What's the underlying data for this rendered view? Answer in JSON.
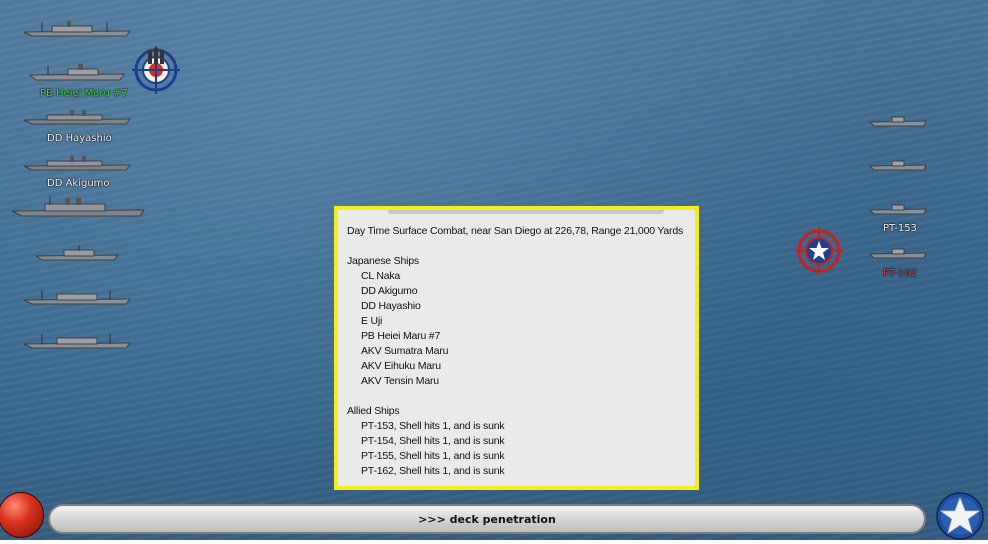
{
  "combat": {
    "header": "Day Time Surface Combat, near San Diego at 226,78, Range 21,000 Yards",
    "japanese_title": "Japanese Ships",
    "japanese_ships": [
      "CL Naka",
      "DD Akigumo",
      "DD Hayashio",
      "E Uji",
      "PB Heiei Maru #7",
      "AKV Sumatra Maru",
      "AKV Eihuku Maru",
      "AKV Tensin Maru"
    ],
    "allied_title": "Allied Ships",
    "allied_ships": [
      "PT-153, Shell hits 1, and is sunk",
      "PT-154, Shell hits 1, and is sunk",
      "PT-155, Shell hits 1, and is sunk",
      "PT-162, Shell hits 1, and is sunk"
    ]
  },
  "left_labels": {
    "heiei": "PB Heiei Maru #7",
    "hayashio": "DD Hayashio",
    "akigumo": "DD Akigumo"
  },
  "right_labels": {
    "pt153": "PT-153",
    "pt162": "PT-162"
  },
  "status_bar": {
    "message": ">>> deck penetration"
  },
  "colors": {
    "panel_border": "#f4ee1a",
    "active_label": "#33e033",
    "enemy_label": "#e63030"
  },
  "icons": [
    "japanese-target-icon",
    "allied-target-icon",
    "red-ball-button-icon",
    "us-star-button-icon"
  ]
}
